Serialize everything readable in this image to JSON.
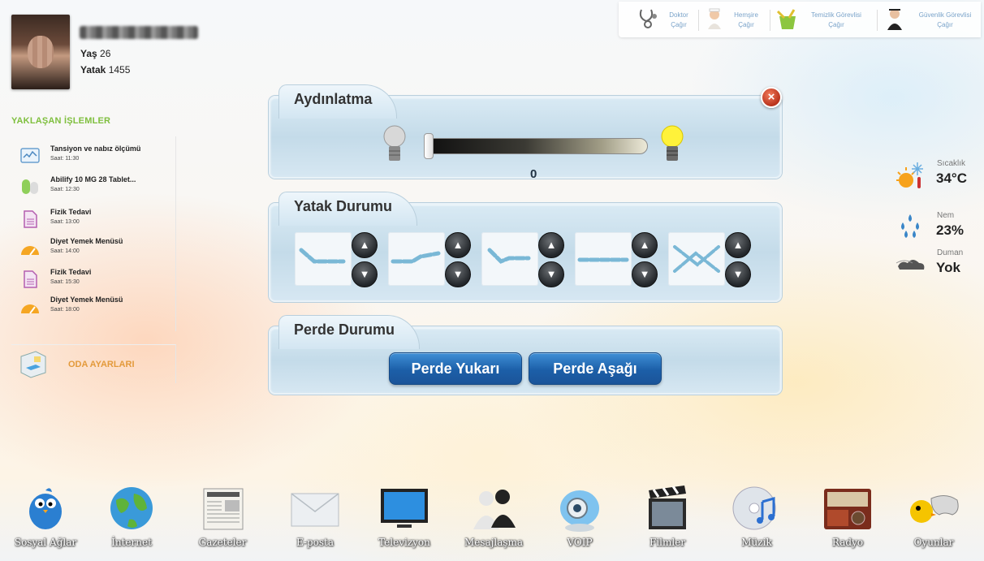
{
  "patient": {
    "age_label": "Yaş",
    "age_value": "26",
    "bed_label": "Yatak",
    "bed_value": "1455"
  },
  "call_buttons": [
    {
      "name": "Doktor",
      "action": "Çağır",
      "icon": "doctor-stethoscope-icon"
    },
    {
      "name": "Hemşire",
      "action": "Çağır",
      "icon": "nurse-icon"
    },
    {
      "name": "Temizlik Görevlisi",
      "action": "Çağır",
      "icon": "cleaning-bucket-icon"
    },
    {
      "name": "Güvenlik Görevlisi",
      "action": "Çağır",
      "icon": "security-guard-icon"
    }
  ],
  "upcoming": {
    "title": "YAKLAŞAN İŞLEMLER",
    "items": [
      {
        "title": "Tansiyon ve nabız ölçümü",
        "time": "Saat: 11:30",
        "icon": "heart-monitor-icon"
      },
      {
        "title": "Abilify 10 MG 28 Tablet...",
        "time": "Saat: 12:30",
        "icon": "pill-icon"
      },
      {
        "title": "Fizik Tedavi",
        "time": "Saat: 13:00",
        "icon": "document-icon"
      },
      {
        "title": "Diyet Yemek Menüsü",
        "time": "Saat: 14:00",
        "icon": "gauge-icon"
      },
      {
        "title": "Fizik Tedavi",
        "time": "Saat: 15:30",
        "icon": "document-icon"
      },
      {
        "title": "Diyet Yemek Menüsü",
        "time": "Saat: 18:00",
        "icon": "gauge-icon"
      }
    ]
  },
  "room_settings": {
    "label": "ODA AYARLARI",
    "icon": "room-icon"
  },
  "lighting": {
    "title": "Aydınlatma",
    "value": "0",
    "level": 0,
    "close": "×"
  },
  "bed_status": {
    "title": "Yatak Durumu",
    "up_symbol": "▲",
    "down_symbol": "▼",
    "positions": [
      "bed-head-raised-icon",
      "bed-legs-raised-icon",
      "bed-sitting-icon",
      "bed-flat-icon",
      "bed-all-icon"
    ]
  },
  "curtain": {
    "title": "Perde Durumu",
    "up_label": "Perde Yukarı",
    "down_label": "Perde Aşağı"
  },
  "weather": {
    "temp_label": "Sıcaklık",
    "temp_value": "34°C",
    "humidity_label": "Nem",
    "humidity_value": "23%",
    "smoke_label": "Duman",
    "smoke_value": "Yok"
  },
  "dock": [
    {
      "label": "Sosyal Ağlar",
      "icon": "twitter-bird-icon"
    },
    {
      "label": "İnternet",
      "icon": "globe-icon"
    },
    {
      "label": "Gazeteler",
      "icon": "newspaper-icon"
    },
    {
      "label": "E-posta",
      "icon": "envelope-icon"
    },
    {
      "label": "Televizyon",
      "icon": "tv-icon"
    },
    {
      "label": "Mesajlaşma",
      "icon": "chat-users-icon"
    },
    {
      "label": "VOIP",
      "icon": "webcam-icon"
    },
    {
      "label": "Filmler",
      "icon": "clapperboard-icon"
    },
    {
      "label": "Müzik",
      "icon": "music-cd-icon"
    },
    {
      "label": "Radyo",
      "icon": "radio-icon"
    },
    {
      "label": "Oyunlar",
      "icon": "gamepad-icon"
    }
  ],
  "colors": {
    "accent_green": "#7fbf3e",
    "accent_orange": "#e39a3b",
    "button_blue": "#1c5fa8",
    "close_red": "#c8361f"
  }
}
